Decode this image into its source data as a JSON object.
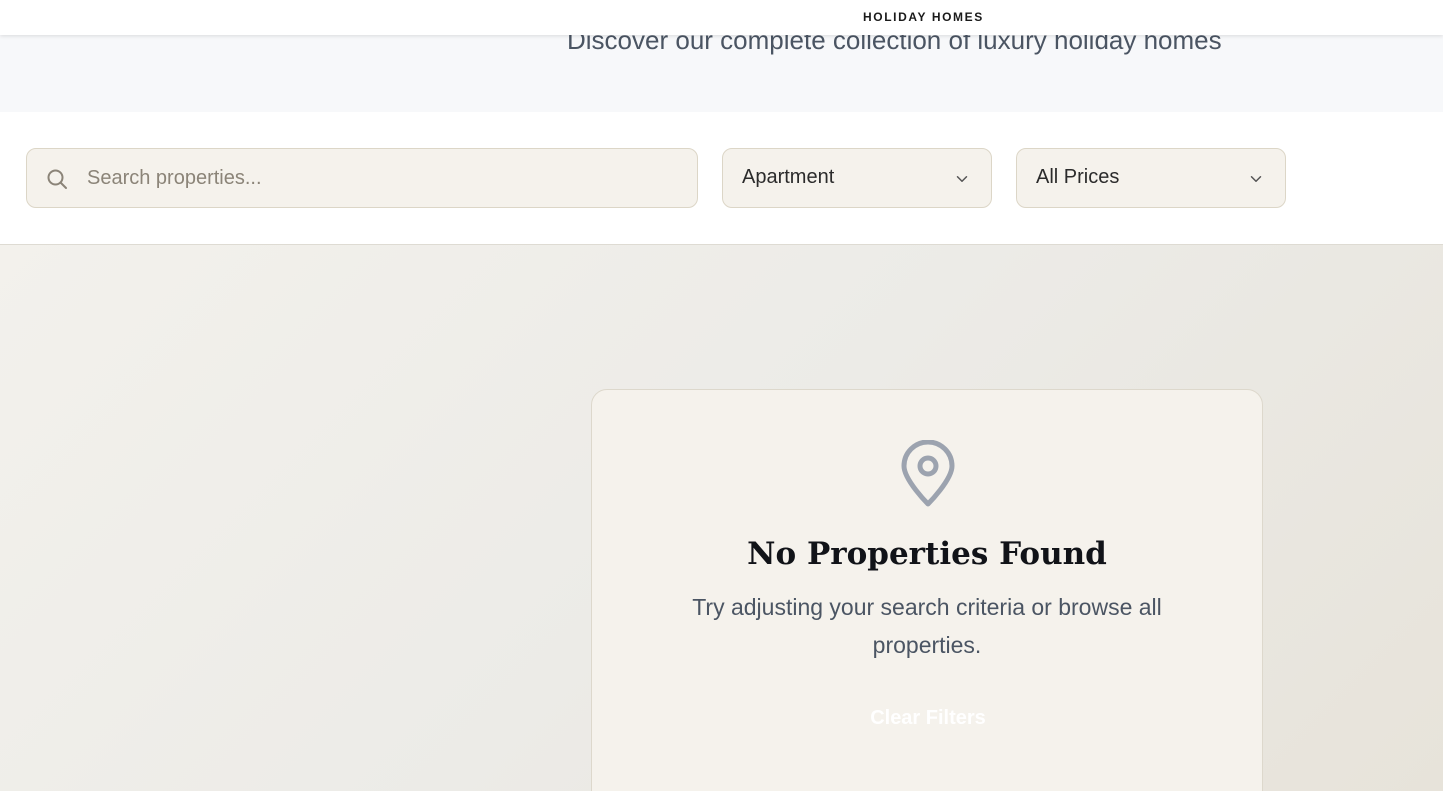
{
  "header": {
    "brand": "HOLIDAY HOMES"
  },
  "hero": {
    "subtitle": "Discover our complete collection of luxury holiday homes"
  },
  "filters": {
    "search": {
      "placeholder": "Search properties...",
      "value": "",
      "icon": "search-icon"
    },
    "property_type": {
      "selected": "Apartment",
      "icon": "chevron-down-icon"
    },
    "price": {
      "selected": "All Prices",
      "icon": "chevron-down-icon"
    }
  },
  "empty_state": {
    "icon": "map-pin-icon",
    "title": "No Properties Found",
    "description": "Try adjusting your search criteria or browse all properties.",
    "clear_button_label": "Clear Filters"
  },
  "colors": {
    "input_bg": "#f5f2ec",
    "input_border": "#dcd6c7",
    "icon_gray": "#9ca3af",
    "title": "#111318",
    "body_text": "#4b5563"
  }
}
